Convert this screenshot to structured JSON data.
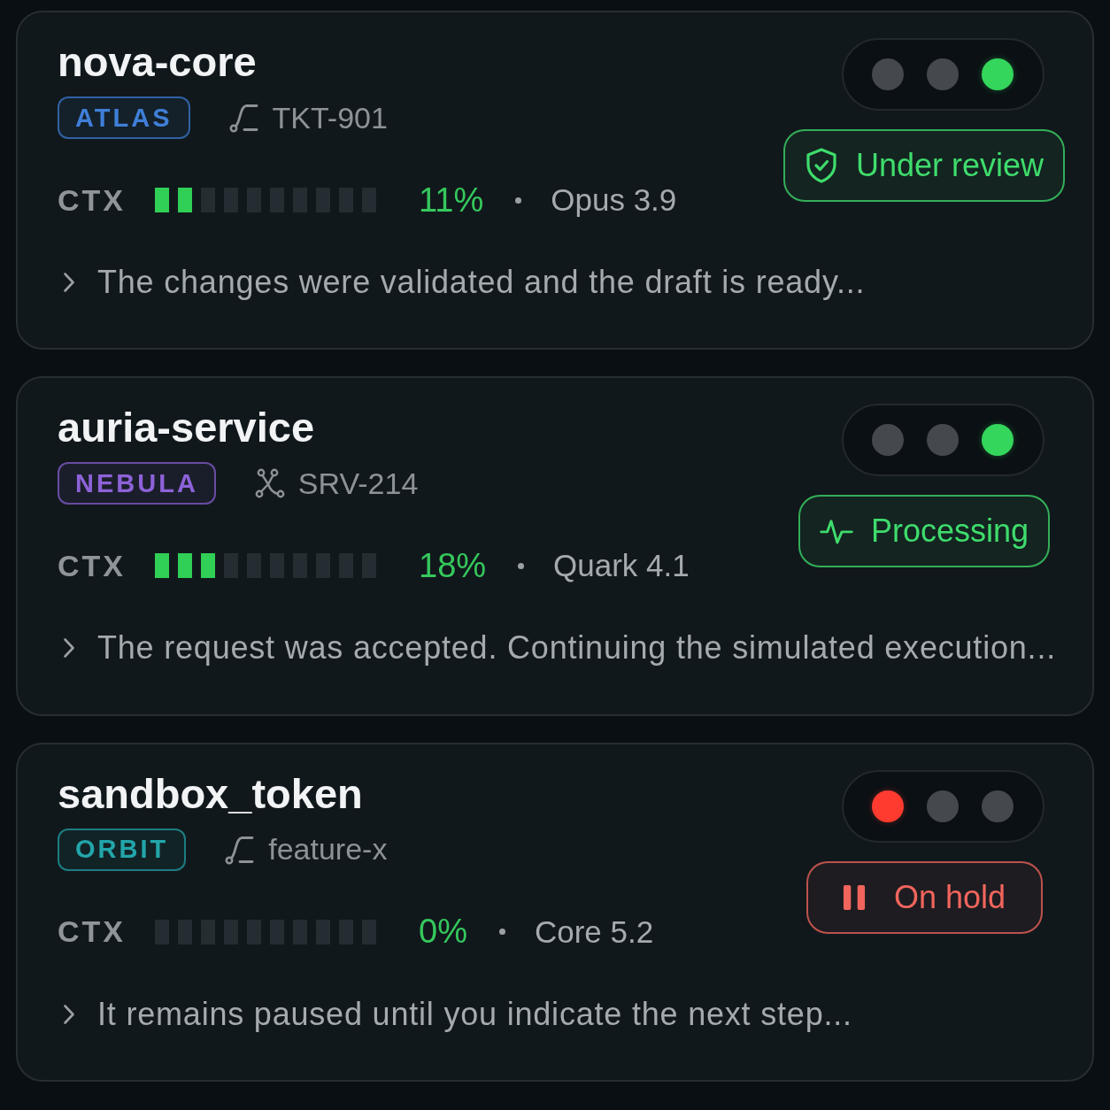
{
  "cards": [
    {
      "title": "nova-core",
      "tag": {
        "label": "ATLAS",
        "color": "#3f7fd8"
      },
      "ref": {
        "kind": "branch",
        "label": "TKT-901"
      },
      "context": {
        "label": "CTX",
        "level": 0.2,
        "reading": "11%"
      },
      "model": "Opus 3.9",
      "lights": [
        {
          "on": false
        },
        {
          "on": false
        },
        {
          "on": true,
          "color": "#34d65b"
        }
      ],
      "status": {
        "kind": "review",
        "label": "Under review",
        "color": "#3fdc6c"
      },
      "message": "The changes were validated and the draft is ready..."
    },
    {
      "title": "auria-service",
      "tag": {
        "label": "NEBULA",
        "color": "#8d62d8"
      },
      "ref": {
        "kind": "graph",
        "label": "SRV-214"
      },
      "context": {
        "label": "CTX",
        "level": 0.3,
        "reading": "18%"
      },
      "model": "Quark 4.1",
      "lights": [
        {
          "on": false
        },
        {
          "on": false
        },
        {
          "on": true,
          "color": "#34d65b"
        }
      ],
      "status": {
        "kind": "processing",
        "label": "Processing",
        "color": "#3fdc6c"
      },
      "message": "The request was accepted. Continuing the simulated execution..."
    },
    {
      "title": "sandbox_token",
      "tag": {
        "label": "ORBIT",
        "color": "#22a6aa"
      },
      "ref": {
        "kind": "branch",
        "label": "feature-x"
      },
      "context": {
        "label": "CTX",
        "level": 0,
        "reading": "0%"
      },
      "model": "Core 5.2",
      "lights": [
        {
          "on": true,
          "color": "#ff3b30"
        },
        {
          "on": false
        },
        {
          "on": false
        }
      ],
      "status": {
        "kind": "hold",
        "label": "On hold",
        "color": "#f2655d"
      },
      "message": "It remains paused until you indicate the next step..."
    }
  ]
}
